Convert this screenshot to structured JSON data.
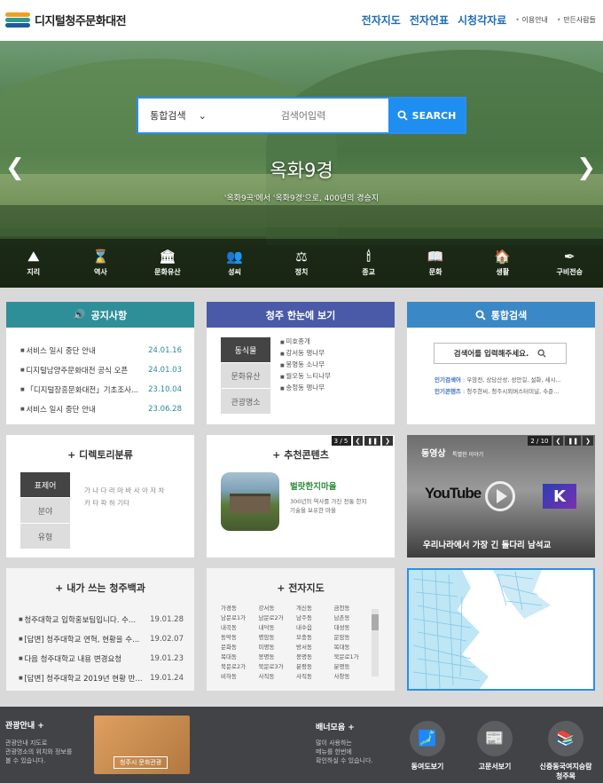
{
  "header": {
    "logo_text": "디지털청주문화대전",
    "nav_main": [
      "전자지도",
      "전자연표",
      "시청각자료"
    ],
    "nav_util": [
      "이용안내",
      "만든사람들"
    ]
  },
  "hero": {
    "search_select": "통합검색",
    "search_placeholder": "검색어입력",
    "search_button": "SEARCH",
    "slide_title": "옥화9경",
    "slide_sub": "'옥화9곡'에서 '옥화9경'으로, 400년의 경승지",
    "categories": [
      {
        "icon": "mountain-icon",
        "glyph": "⛰",
        "label": "지리"
      },
      {
        "icon": "hourglass-icon",
        "glyph": "⌛",
        "label": "역사"
      },
      {
        "icon": "heritage-building-icon",
        "glyph": "🏛",
        "label": "문화유산"
      },
      {
        "icon": "people-icon",
        "glyph": "👥",
        "label": "성씨"
      },
      {
        "icon": "gavel-icon",
        "glyph": "⚖",
        "label": "정치"
      },
      {
        "icon": "candle-icon",
        "glyph": "🕯",
        "label": "종교"
      },
      {
        "icon": "book-icon",
        "glyph": "📖",
        "label": "문화"
      },
      {
        "icon": "daily-life-icon",
        "glyph": "🏠",
        "label": "생활"
      },
      {
        "icon": "pen-icon",
        "glyph": "✒",
        "label": "구비전승"
      }
    ]
  },
  "notice": {
    "title": "공지사항",
    "items": [
      {
        "text": "서비스 일시 중단 안내",
        "date": "24.01.16"
      },
      {
        "text": "디지털남양주문화대전 공식 오픈",
        "date": "24.01.03"
      },
      {
        "text": "「디지털장흥문화대전」기초조사...",
        "date": "23.10.04"
      },
      {
        "text": "서비스 일시 중단 안내",
        "date": "23.06.28"
      }
    ]
  },
  "glance": {
    "title": "청주 한눈에 보기",
    "tabs": [
      "동식물",
      "문화유산",
      "관광명소"
    ],
    "items": [
      "미호종개",
      "강서동 팽나무",
      "봉명동 소나무",
      "월오동 느티나무",
      "송정동 팽나무"
    ]
  },
  "integrated": {
    "title": "통합검색",
    "placeholder": "검색어를 입력해주세요.",
    "popular_keywords_label": "인기검색어",
    "popular_keywords": "우암전, 상당산성, 성안길, 설화, 세시...",
    "popular_contents_label": "인기콘텐츠",
    "popular_contents": "청주한씨, 청주시외버스터미널, 수준..."
  },
  "directory": {
    "title": "+ 디렉토리분류",
    "tabs": [
      "표제어",
      "분야",
      "유형"
    ],
    "letters_row1": "가 나 다 라 마 바 사 아 자 차",
    "letters_row2": "카 타 파 하 기타"
  },
  "recommend": {
    "title": "+ 추천콘텐츠",
    "pager": "3 / 5",
    "item_title": "벌랏한지마을",
    "item_desc_1": "300년의 역사를 가진 전통 한지",
    "item_desc_2": "기술을 보유한 마을"
  },
  "video": {
    "title": "동영상",
    "subtitle": "특별한 이야기",
    "pager": "2 / 10",
    "youtube": "YouTube",
    "caption": "우리나라에서 가장 긴 돌다리 남석교"
  },
  "wiki": {
    "title": "+ 내가 쓰는 청주백과",
    "items": [
      {
        "text": "청주대학교 입학홍보팀입니다. 수...",
        "date": "19.01.28"
      },
      {
        "text": "[답변] 청주대학교 연혁, 현황을 수...",
        "date": "19.02.07"
      },
      {
        "text": "다음 청주대학교 내용 변경요청",
        "date": "19.01.23"
      },
      {
        "text": "[답변] 청주대학교 2019년 현황 반...",
        "date": "19.01.24"
      }
    ]
  },
  "emap": {
    "title": "+ 전자지도",
    "places": [
      "가경동",
      "강서동",
      "개신동",
      "금천동",
      "남문로1가",
      "남문로2가",
      "남주동",
      "남촌동",
      "내곡동",
      "내덕동",
      "내수읍",
      "대성동",
      "동막동",
      "명암동",
      "모충동",
      "문암동",
      "문화동",
      "미평동",
      "방서동",
      "복대동",
      "복대동",
      "봉명동",
      "봉명동",
      "북문로1가",
      "북문로2가",
      "북문로3가",
      "분평동",
      "분평동",
      "비하동",
      "사직동",
      "사직동",
      "사창동"
    ]
  },
  "footer": {
    "tour_title": "관광안내",
    "tour_desc": [
      "관광안내 지도로",
      "관광명소의 위치와 정보를",
      "볼 수 있습니다."
    ],
    "tour_button": "청주시 문화관광",
    "banner_title": "배너모음",
    "banner_desc": [
      "많이 사용하는",
      "메뉴를 한번에",
      "확인하실 수 있습니다."
    ],
    "links": [
      {
        "icon": "korea-map-icon",
        "glyph": "🗾",
        "label": "동여도보기"
      },
      {
        "icon": "document-icon",
        "glyph": "📰",
        "label": "고문서보기"
      },
      {
        "icon": "books-icon",
        "glyph": "📚",
        "label": "신증동국여지승람 청주목"
      }
    ]
  },
  "colors": {
    "notice_header": "#2f8f99",
    "glance_header": "#4a5aa8",
    "search_header": "#3a88c6",
    "accent_blue": "#1e8ef0"
  }
}
